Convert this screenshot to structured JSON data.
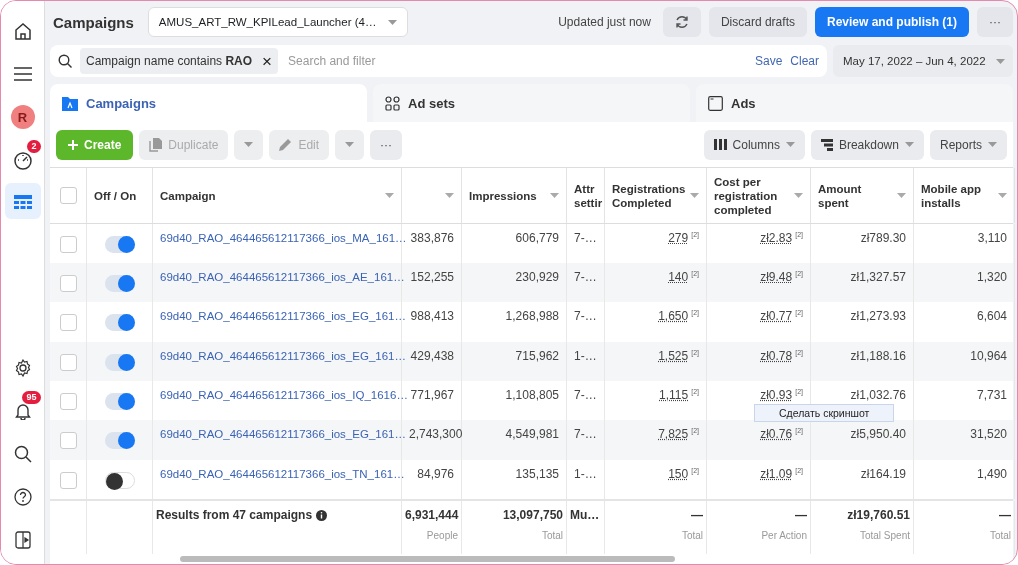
{
  "sidebar": {
    "top": [
      {
        "kind": "home",
        "selected": false
      },
      {
        "kind": "menu",
        "selected": false
      },
      {
        "kind": "avatar",
        "letter": "R",
        "selected": false
      },
      {
        "kind": "gauge",
        "badge": "2",
        "selected": false
      },
      {
        "kind": "table",
        "selected": true
      }
    ],
    "bottom": [
      {
        "kind": "settings",
        "selected": false
      },
      {
        "kind": "bell",
        "badge": "95",
        "selected": false
      },
      {
        "kind": "search",
        "selected": false
      },
      {
        "kind": "help",
        "selected": false
      },
      {
        "kind": "panel",
        "selected": false
      }
    ]
  },
  "header": {
    "title": "Campaigns",
    "account": "AMUS_ART_RW_KPILead_Launcher (4…",
    "updated": "Updated just now",
    "discard": "Discard drafts",
    "publish": "Review and publish (1)",
    "more": "···"
  },
  "filter": {
    "chip": "Campaign name contains **RAO**",
    "chip_close": "×",
    "placeholder": "Search and filter",
    "save": "Save",
    "clear": "Clear",
    "date_range": "May 17, 2022 – Jun 4, 2022"
  },
  "tabs": [
    {
      "kind": "campaigns",
      "label": "Campaigns",
      "selected": true
    },
    {
      "kind": "adsets",
      "label": "Ad sets",
      "selected": false
    },
    {
      "kind": "ads",
      "label": "Ads",
      "selected": false
    }
  ],
  "toolbar": {
    "create": "Create",
    "duplicate": {
      "label": "Duplicate",
      "disabled": true
    },
    "edit": {
      "label": "Edit",
      "disabled": true
    },
    "more": "···",
    "columns": "Columns",
    "breakdown": "Breakdown",
    "reports": "Reports"
  },
  "table": {
    "header_checked": false,
    "columns": [
      {
        "label": "Off / On",
        "sortable": false
      },
      {
        "label": "Campaign",
        "sortable": true
      },
      {
        "sortable": true
      },
      {
        "label": "Impressions",
        "sortable": true
      },
      {
        "label": "Attr settir"
      },
      {
        "label": "Registrations Completed",
        "sortable": true
      },
      {
        "label": "Cost per registration completed",
        "sortable": true
      },
      {
        "label": "Amount spent",
        "sortable": true
      },
      {
        "label": "Mobile app installs",
        "sortable": true
      }
    ],
    "rows": [
      {
        "checked": false,
        "on": true,
        "campaign": "69d40_RAO_464465612117366_ios_MA_161…",
        "column_3": "383,876",
        "impressions": "606,779",
        "attr": "7-…",
        "registrations": "279",
        "registrations_note": "[2]",
        "cost": "zł2.83",
        "cost_note": "[2]",
        "amount": "zł789.30",
        "installs": "3,110"
      },
      {
        "checked": false,
        "on": true,
        "campaign": "69d40_RAO_464465612117366_ios_AE_161…",
        "column_3": "152,255",
        "impressions": "230,929",
        "attr": "7-…",
        "registrations": "140",
        "registrations_note": "[2]",
        "cost": "zł9.48",
        "cost_note": "[2]",
        "amount": "zł1,327.57",
        "installs": "1,320"
      },
      {
        "checked": false,
        "on": true,
        "campaign": "69d40_RAO_464465612117366_ios_EG_161…",
        "column_3": "988,413",
        "impressions": "1,268,988",
        "attr": "7-…",
        "registrations": "1,650",
        "registrations_note": "[2]",
        "cost": "zł0.77",
        "cost_note": "[2]",
        "amount": "zł1,273.93",
        "installs": "6,604"
      },
      {
        "checked": false,
        "on": true,
        "campaign": "69d40_RAO_464465612117366_ios_EG_161…",
        "column_3": "429,438",
        "impressions": "715,962",
        "attr": "1-…",
        "registrations": "1,525",
        "registrations_note": "[2]",
        "cost": "zł0.78",
        "cost_note": "[2]",
        "amount": "zł1,188.16",
        "installs": "10,964"
      },
      {
        "checked": false,
        "on": true,
        "campaign": "69d40_RAO_464465612117366_ios_IQ_1616…",
        "column_3": "771,967",
        "impressions": "1,108,805",
        "attr": "7-…",
        "registrations": "1,115",
        "registrations_note": "[2]",
        "cost": "zł0.93",
        "cost_note": "[2]",
        "amount": "zł1,032.76",
        "installs": "7,731"
      },
      {
        "checked": false,
        "on": true,
        "campaign": "69d40_RAO_464465612117366_ios_EG_161…",
        "column_3": "2,743,300",
        "impressions": "4,549,981",
        "attr": "7-…",
        "registrations": "7,825",
        "registrations_note": "[2]",
        "cost": "zł0.76",
        "cost_note": "[2]",
        "amount": "zł5,950.40",
        "installs": "31,520"
      },
      {
        "checked": false,
        "on": false,
        "campaign": "69d40_RAO_464465612117366_ios_TN_161…",
        "column_3": "84,976",
        "impressions": "135,135",
        "attr": "1-…",
        "registrations": "150",
        "registrations_note": "[2]",
        "cost": "zł1.09",
        "cost_note": "[2]",
        "amount": "zł164.19",
        "installs": "1,490"
      }
    ],
    "footer": {
      "label": "Results from 47 campaigns",
      "totals": [
        {
          "value": "6,931,444",
          "sub": "People"
        },
        {
          "value": "13,097,750",
          "sub": "Total"
        },
        {
          "value": "Mu…"
        },
        {
          "value": "—",
          "sub": "Total"
        },
        {
          "value": "—",
          "sub": "Per Action"
        },
        {
          "value": "zł19,760.51",
          "sub": "Total Spent"
        },
        {
          "value": "—",
          "sub": "Total"
        }
      ]
    }
  },
  "context_menu": {
    "item": "Сделать скриншот"
  }
}
